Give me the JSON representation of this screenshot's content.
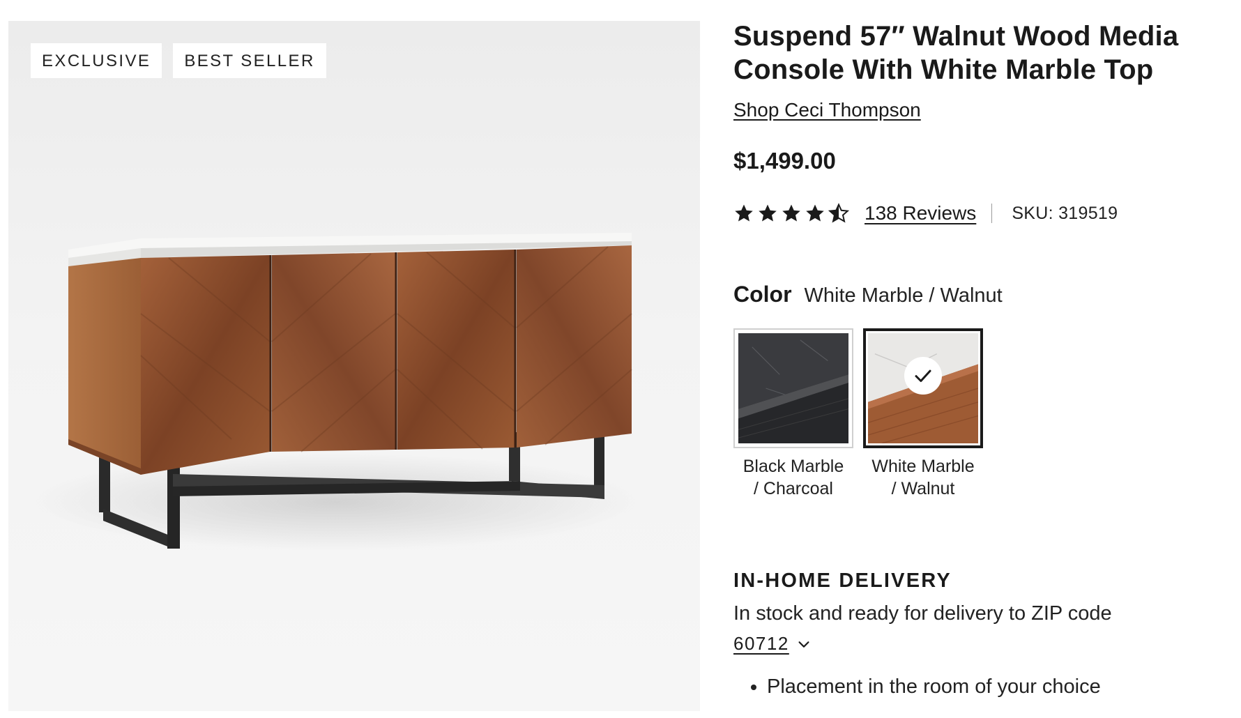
{
  "badges": [
    "EXCLUSIVE",
    "BEST SELLER"
  ],
  "product": {
    "title": "Suspend 57″ Walnut Wood Media Console With White Marble Top",
    "designer_link": "Shop Ceci Thompson",
    "price": "$1,499.00",
    "rating": 4.5,
    "rating_max": 5,
    "reviews_link": "138 Reviews",
    "sku": "SKU: 319519"
  },
  "color": {
    "label": "Color",
    "selected_value": "White Marble / Walnut",
    "options": [
      {
        "name_line1": "Black Marble",
        "name_line2": "/ Charcoal",
        "selected": false
      },
      {
        "name_line1": "White Marble",
        "name_line2": "/ Walnut",
        "selected": true
      }
    ]
  },
  "delivery": {
    "title": "IN-HOME DELIVERY",
    "text": "In stock and ready for delivery to ZIP code",
    "zip": "60712",
    "bullets": [
      "Placement in the room of your choice"
    ]
  },
  "colors": {
    "text": "#1a1a1a",
    "walnut": "#9a5a32",
    "marble": "#f4f4f2",
    "frame": "#2e2e2e"
  }
}
